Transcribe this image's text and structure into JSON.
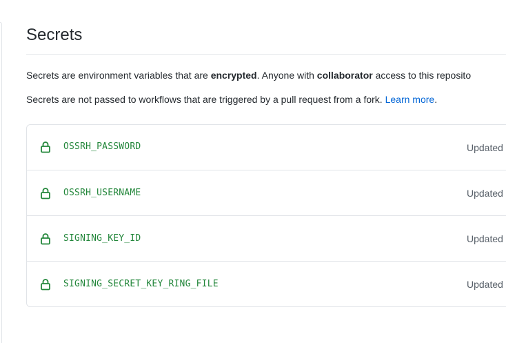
{
  "page": {
    "title": "Secrets"
  },
  "description": {
    "line1_part1": "Secrets are environment variables that are ",
    "line1_bold1": "encrypted",
    "line1_part2": ". Anyone with ",
    "line1_bold2": "collaborator",
    "line1_part3": " access to this reposito",
    "line2_text": "Secrets are not passed to workflows that are triggered by a pull request from a fork. ",
    "line2_link": "Learn more",
    "line2_end": "."
  },
  "secrets": [
    {
      "name": "OSSRH_PASSWORD",
      "icon": "lock-icon",
      "updated": "Updated"
    },
    {
      "name": "OSSRH_USERNAME",
      "icon": "lock-icon",
      "updated": "Updated"
    },
    {
      "name": "SIGNING_KEY_ID",
      "icon": "lock-icon",
      "updated": "Updated"
    },
    {
      "name": "SIGNING_SECRET_KEY_RING_FILE",
      "icon": "lock-icon",
      "updated": "Updated"
    }
  ],
  "colors": {
    "secret_name": "#22863a",
    "link": "#0366d6",
    "border": "#e1e4e8",
    "muted": "#586069"
  }
}
